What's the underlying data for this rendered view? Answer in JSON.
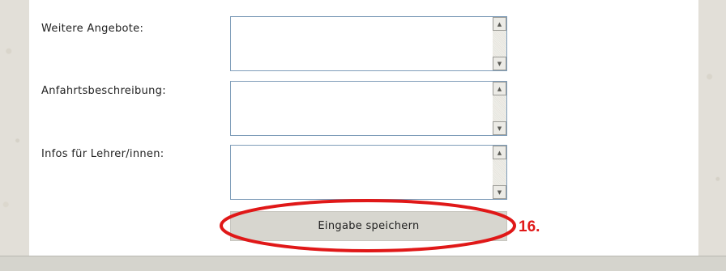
{
  "form": {
    "fields": [
      {
        "label": "Weitere Angebote:",
        "value": ""
      },
      {
        "label": "Anfahrtsbeschreibung:",
        "value": ""
      },
      {
        "label": "Infos für Lehrer/innen:",
        "value": ""
      }
    ],
    "save_label": "Eingabe speichern"
  },
  "annotation": {
    "step_number": "16.",
    "color": "#e01818"
  },
  "icons": {
    "scroll_up": "scroll-up-arrow-icon",
    "scroll_down": "scroll-down-arrow-icon"
  }
}
